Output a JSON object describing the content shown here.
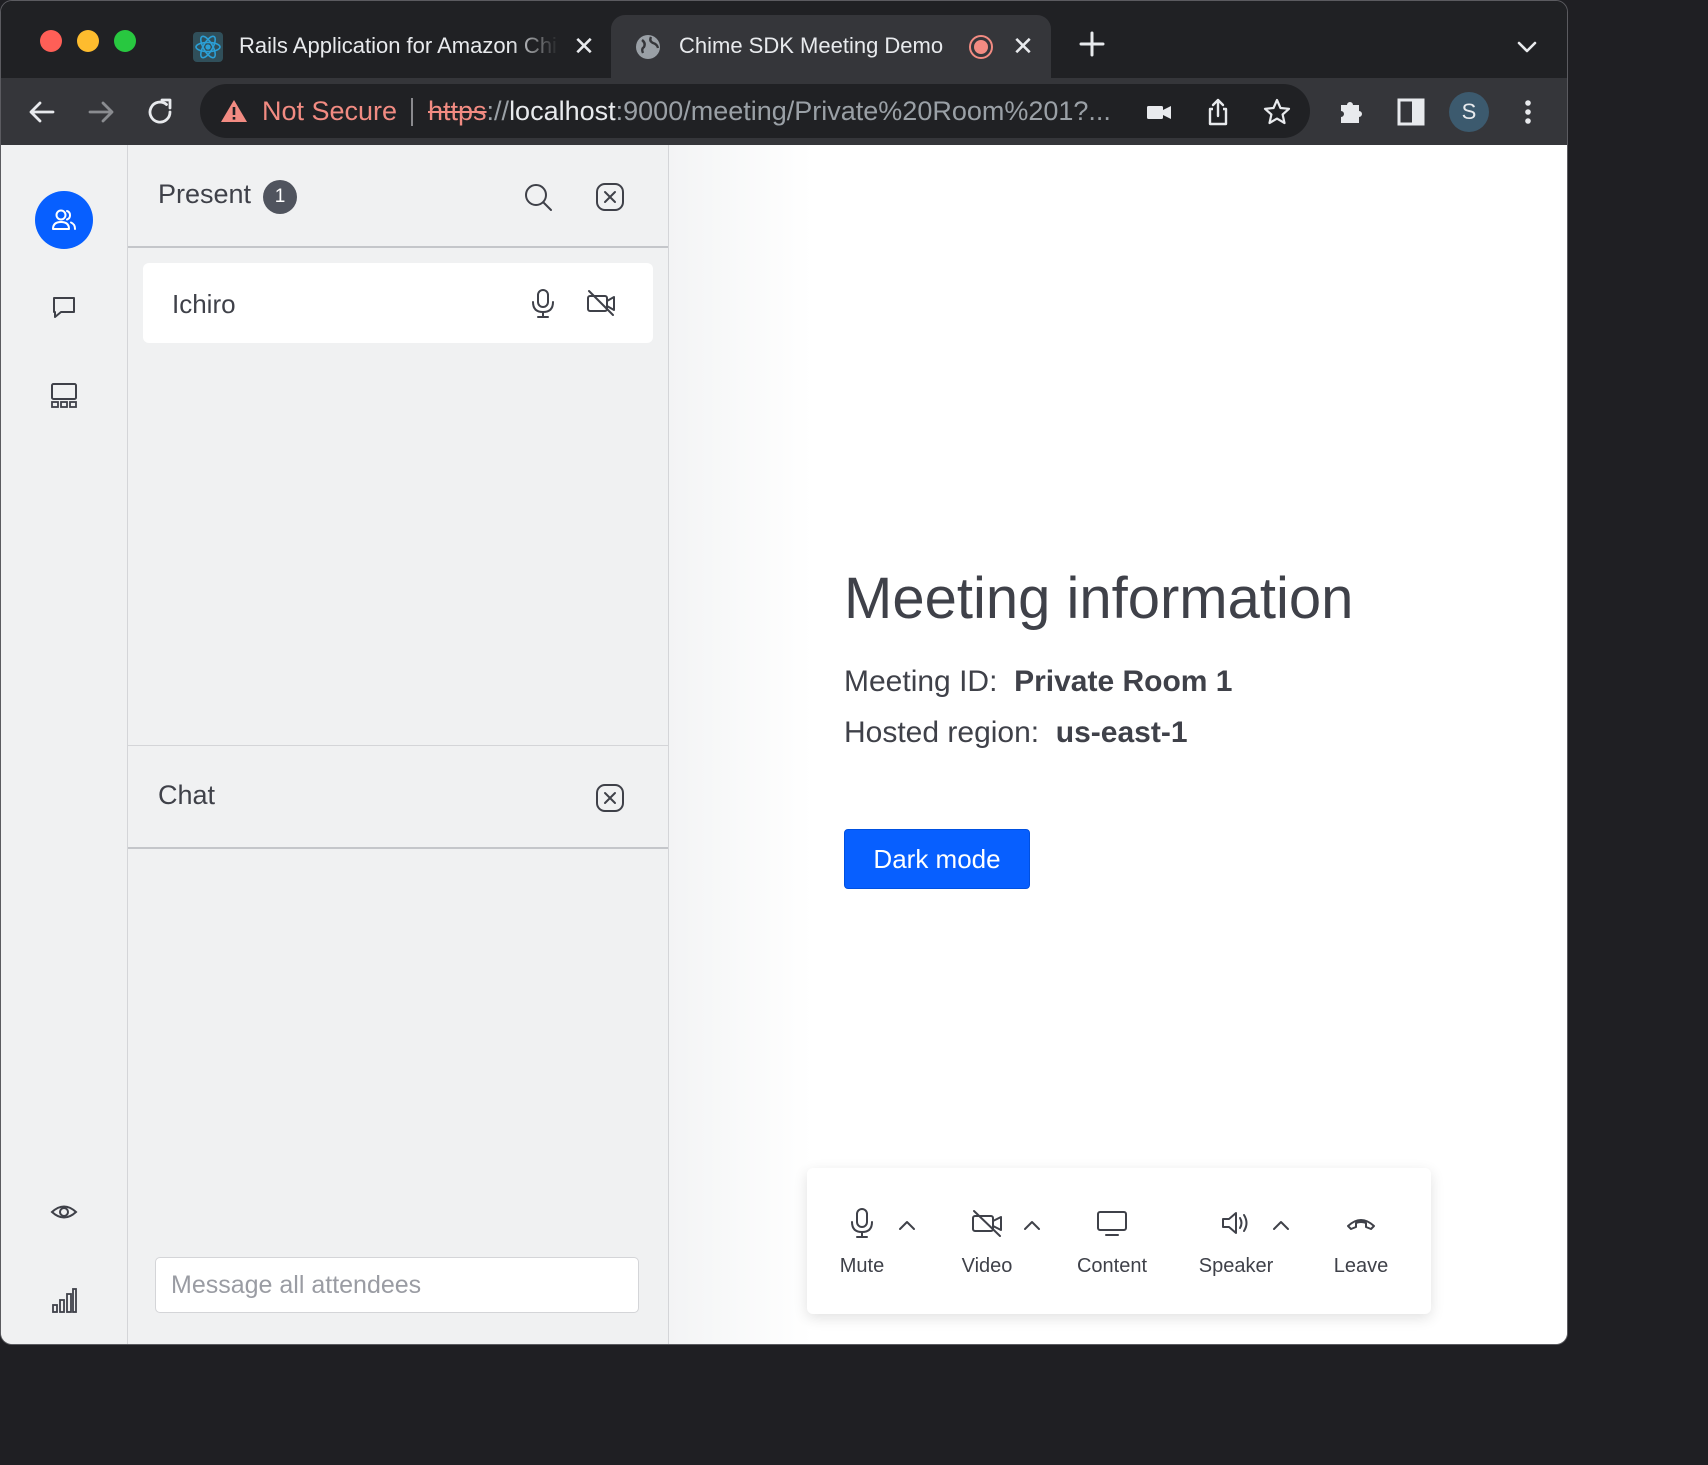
{
  "browser": {
    "tabs": [
      {
        "title": "Rails Application for Amazon Chime SDK Meeting",
        "icon": "react-icon"
      },
      {
        "title": "Chime SDK Meeting Demo",
        "icon": "globe-icon",
        "recording": true
      }
    ],
    "security_label": "Not Secure",
    "url": {
      "scheme": "https",
      "sep": "://",
      "host": "localhost",
      "rest": ":9000/meeting/Private%20Room%201?..."
    },
    "profile_initial": "S"
  },
  "roster": {
    "title": "Present",
    "count": "1",
    "attendees": [
      {
        "name": "Ichiro"
      }
    ]
  },
  "chat": {
    "title": "Chat",
    "input_placeholder": "Message all attendees"
  },
  "meeting_info": {
    "heading": "Meeting information",
    "id_label": "Meeting ID:",
    "id_value": "Private Room 1",
    "region_label": "Hosted region:",
    "region_value": "us-east-1",
    "dark_mode_label": "Dark mode"
  },
  "controls": {
    "mute": "Mute",
    "video": "Video",
    "content": "Content",
    "speaker": "Speaker",
    "leave": "Leave"
  },
  "colors": {
    "accent": "#075fff",
    "warning": "#f28b82",
    "panel_bg": "#f0f1f2",
    "text": "#3f4149"
  }
}
